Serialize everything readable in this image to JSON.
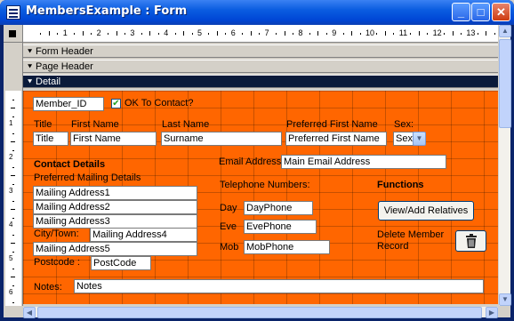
{
  "window": {
    "title": "MembersExample : Form",
    "minimize_glyph": "_",
    "maximize_glyph": "□",
    "close_glyph": "✕"
  },
  "ruler": {
    "h_labels": [
      "1",
      "2",
      "3",
      "4",
      "5",
      "6",
      "7",
      "8",
      "9",
      "10",
      "11",
      "12",
      "13",
      "14"
    ],
    "v_labels": [
      "1",
      "2",
      "3",
      "4",
      "5",
      "6"
    ]
  },
  "sections": {
    "form_header": "Form Header",
    "page_header": "Page Header",
    "detail": "Detail"
  },
  "form": {
    "member_id": "Member_ID",
    "ok_to_contact_label": "OK To Contact?",
    "ok_to_contact_checked": true,
    "title_label": "Title",
    "title_field": "Title",
    "first_name_label": "First Name",
    "first_name_field": "First Name",
    "last_name_label": "Last Name",
    "last_name_field": "Surname",
    "pref_first_label": "Preferred First Name",
    "pref_first_field": "Preferred First Name",
    "sex_label": "Sex:",
    "sex_field": "Sex",
    "contact_heading": "Contact Details",
    "pref_mailing_label": "Preferred Mailing Details",
    "addr1": "Mailing Address1",
    "addr2": "Mailing Address2",
    "addr3": "Mailing Address3",
    "city_label": "City/Town:",
    "addr4": "Mailing Address4",
    "addr5": "Mailing Address5",
    "postcode_label": "Postcode :",
    "postcode_field": "PostCode",
    "notes_label": "Notes:",
    "notes_field": "Notes",
    "email_label": "Email Address",
    "email_field": "Main Email Address",
    "telephone_label": "Telephone  Numbers:",
    "day_label": "Day",
    "day_field": "DayPhone",
    "eve_label": "Eve",
    "eve_field": "EvePhone",
    "mob_label": "Mob",
    "mob_field": "MobPhone",
    "functions_heading": "Functions",
    "view_add_button": "View/Add Relatives",
    "delete_label": "Delete Member Record",
    "delete_icon": "trash-icon"
  },
  "colors": {
    "detail_background": "#ff6600",
    "title_bar": "#0a5ce0"
  }
}
